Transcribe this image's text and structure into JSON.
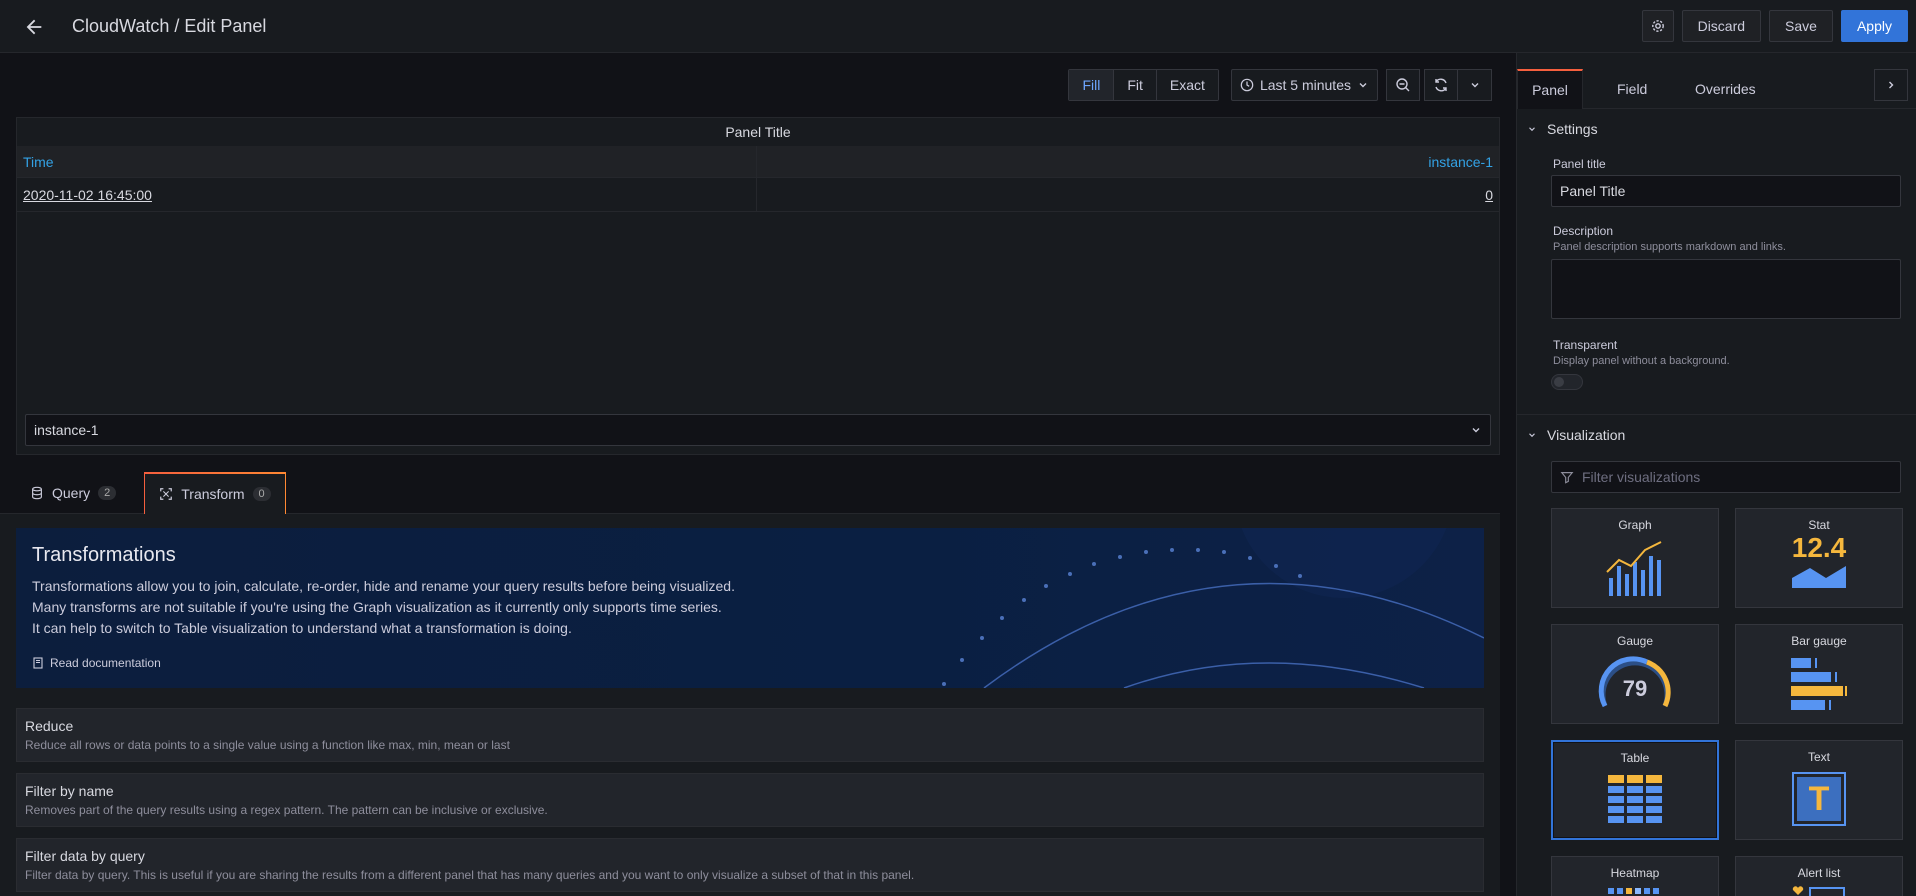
{
  "header": {
    "title": "CloudWatch / Edit Panel",
    "discard_label": "Discard",
    "save_label": "Save",
    "apply_label": "Apply"
  },
  "viz_toolbar": {
    "fill": "Fill",
    "fit": "Fit",
    "exact": "Exact",
    "time_range": "Last 5 minutes"
  },
  "panel": {
    "title": "Panel Title",
    "columns": [
      "Time",
      "instance-1"
    ],
    "rows": [
      [
        "2020-11-02 16:45:00",
        "0"
      ]
    ],
    "series_select": "instance-1"
  },
  "editor_tabs": [
    {
      "label": "Query",
      "count": "2"
    },
    {
      "label": "Transform",
      "count": "0"
    }
  ],
  "transformations": {
    "heading": "Transformations",
    "lines": [
      "Transformations allow you to join, calculate, re-order, hide and rename your query results before being visualized.",
      "Many transforms are not suitable if you're using the Graph visualization as it currently only supports time series.",
      "It can help to switch to Table visualization to understand what a transformation is doing."
    ],
    "read_docs": "Read documentation",
    "items": [
      {
        "title": "Reduce",
        "desc": "Reduce all rows or data points to a single value using a function like max, min, mean or last"
      },
      {
        "title": "Filter by name",
        "desc": "Removes part of the query results using a regex pattern. The pattern can be inclusive or exclusive."
      },
      {
        "title": "Filter data by query",
        "desc": "Filter data by query. This is useful if you are sharing the results from a different panel that has many queries and you want to only visualize a subset of that in this panel."
      }
    ]
  },
  "sidebar": {
    "tabs": [
      "Panel",
      "Field",
      "Overrides"
    ],
    "settings": {
      "heading": "Settings",
      "panel_title_label": "Panel title",
      "panel_title_value": "Panel Title",
      "description_label": "Description",
      "description_hint": "Panel description supports markdown and links.",
      "transparent_label": "Transparent",
      "transparent_hint": "Display panel without a background."
    },
    "visualization": {
      "heading": "Visualization",
      "filter_placeholder": "Filter visualizations",
      "tiles": [
        "Graph",
        "Stat",
        "Gauge",
        "Bar gauge",
        "Table",
        "Text",
        "Heatmap",
        "Alert list"
      ],
      "selected": "Table",
      "stat_value": "12.4",
      "gauge_value": "79",
      "text_glyph": "T"
    }
  },
  "colors": {
    "accent": "#3274d9",
    "link": "#33a2e5",
    "tab_gradient_start": "#f55f3e",
    "tab_gradient_end": "#ff8833",
    "viz_yellow": "#f5b73d",
    "viz_blue": "#5794f2"
  }
}
